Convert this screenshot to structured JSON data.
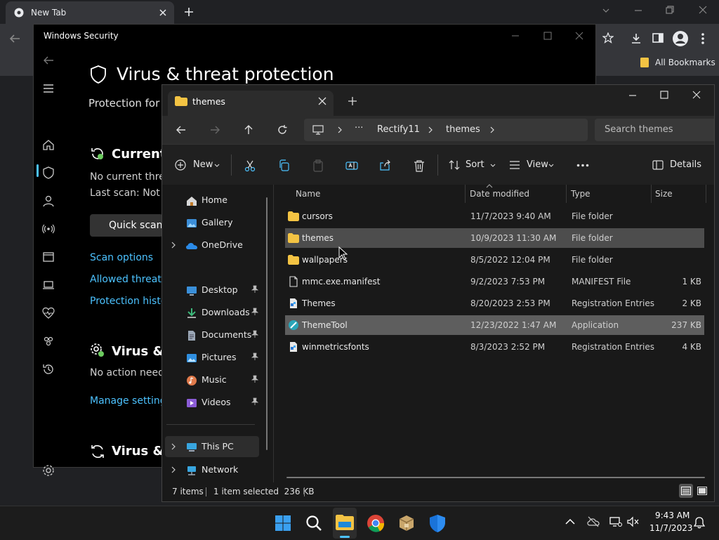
{
  "chrome": {
    "tab_title": "New Tab",
    "bookmarks_label": "All Bookmarks"
  },
  "windows_security": {
    "window_title": "Windows Security",
    "page_title": "Virus & threat protection",
    "subtitle": "Protection for y",
    "current_threats_heading": "Current",
    "no_current_threats": "No current thre",
    "last_scan": "Last scan: Not a",
    "quick_scan_button": "Quick scan",
    "scan_options_link": "Scan options",
    "allowed_threats_link": "Allowed threats",
    "protection_history_link": "Protection histor",
    "settings_heading": "Virus &",
    "no_action_needed": "No action need",
    "manage_settings_link": "Manage settings",
    "updates_heading": "Virus &"
  },
  "explorer": {
    "tab_title": "themes",
    "breadcrumb": [
      "Rectify11",
      "themes"
    ],
    "search_placeholder": "Search themes",
    "command_bar": {
      "new_label": "New",
      "sort_label": "Sort",
      "view_label": "View",
      "details_label": "Details"
    },
    "sidebar": {
      "items": [
        {
          "label": "Home",
          "icon": "home-icon"
        },
        {
          "label": "Gallery",
          "icon": "gallery-icon"
        },
        {
          "label": "OneDrive",
          "icon": "onedrive-icon"
        },
        {
          "label": "Desktop",
          "icon": "desktop-icon"
        },
        {
          "label": "Downloads",
          "icon": "downloads-icon"
        },
        {
          "label": "Documents",
          "icon": "documents-icon"
        },
        {
          "label": "Pictures",
          "icon": "pictures-icon"
        },
        {
          "label": "Music",
          "icon": "music-icon"
        },
        {
          "label": "Videos",
          "icon": "videos-icon"
        },
        {
          "label": "This PC",
          "icon": "this-pc-icon"
        },
        {
          "label": "Network",
          "icon": "network-icon"
        }
      ]
    },
    "columns": [
      "Name",
      "Date modified",
      "Type",
      "Size"
    ],
    "rows": [
      {
        "name": "cursors",
        "date": "11/7/2023 9:40 AM",
        "type": "File folder",
        "size": ""
      },
      {
        "name": "themes",
        "date": "10/9/2023 11:30 AM",
        "type": "File folder",
        "size": ""
      },
      {
        "name": "wallpapers",
        "date": "8/5/2022 12:04 PM",
        "type": "File folder",
        "size": ""
      },
      {
        "name": "mmc.exe.manifest",
        "date": "9/2/2023 7:53 PM",
        "type": "MANIFEST File",
        "size": "1 KB"
      },
      {
        "name": "Themes",
        "date": "8/20/2023 2:53 PM",
        "type": "Registration Entries",
        "size": "2 KB"
      },
      {
        "name": "ThemeTool",
        "date": "12/23/2022 1:47 AM",
        "type": "Application",
        "size": "237 KB"
      },
      {
        "name": "winmetricsfonts",
        "date": "8/3/2023 2:52 PM",
        "type": "Registration Entries",
        "size": "4 KB"
      }
    ],
    "status": {
      "items_count": "7 items",
      "selection": "1 item selected  236 KB"
    }
  },
  "taskbar": {
    "time": "9:43 AM",
    "date": "11/7/2023"
  },
  "colors": {
    "accent_link": "#4cc2ff",
    "folder": "#f3c343",
    "selection": "#4d4d4d"
  }
}
